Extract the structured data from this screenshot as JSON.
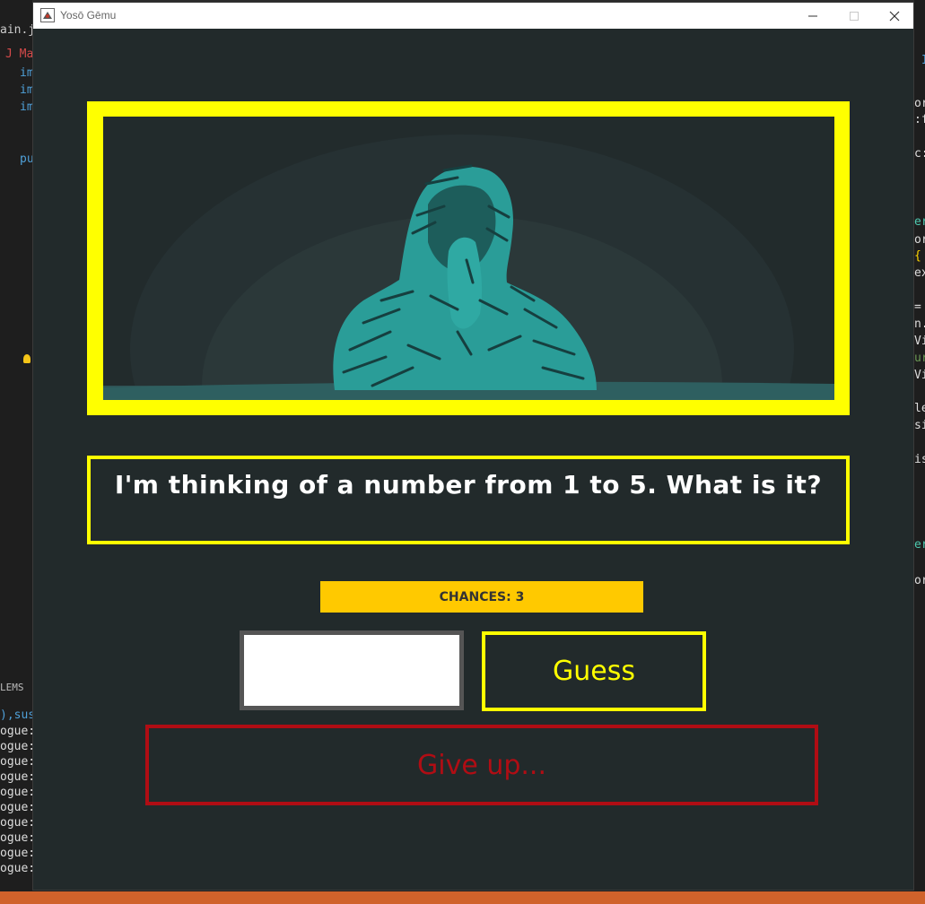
{
  "window": {
    "title": "Yosō Gēmu",
    "minimize_icon": "minimize-icon",
    "maximize_icon": "maximize-icon",
    "close_icon": "close-icon"
  },
  "game": {
    "image_description_icon": "hooded-figure-illustration",
    "question": "I'm thinking of a number from 1 to 5. What is it?",
    "chances_label": "CHANCES: 3",
    "guess_input_value": "",
    "guess_label": "Guess",
    "give_up_label": "Give up..."
  },
  "background_ide": {
    "left_lines": [
      "ain.java",
      "J  Ma",
      "im",
      "im",
      "im",
      "pu",
      "LEMS",
      "),susp",
      "ogue:",
      "ogue:",
      "ogue:",
      "ogue:",
      "ogue:",
      "ogue:",
      "ogue:",
      "ogue:",
      "ogue:",
      "ogue:"
    ],
    "right_lines": [
      "I",
      "or",
      ":f",
      "c:",
      "er",
      "or",
      "{",
      "ex",
      "=",
      "n.",
      "Vi",
      "ur",
      "Vi",
      "le",
      "si",
      "is",
      "er",
      "or"
    ]
  },
  "colors": {
    "accent_yellow": "#ffff00",
    "chances_bg": "#ffc900",
    "give_up_red": "#b00d14",
    "window_bg": "#222a2b",
    "figure_teal": "#2a9d98"
  }
}
